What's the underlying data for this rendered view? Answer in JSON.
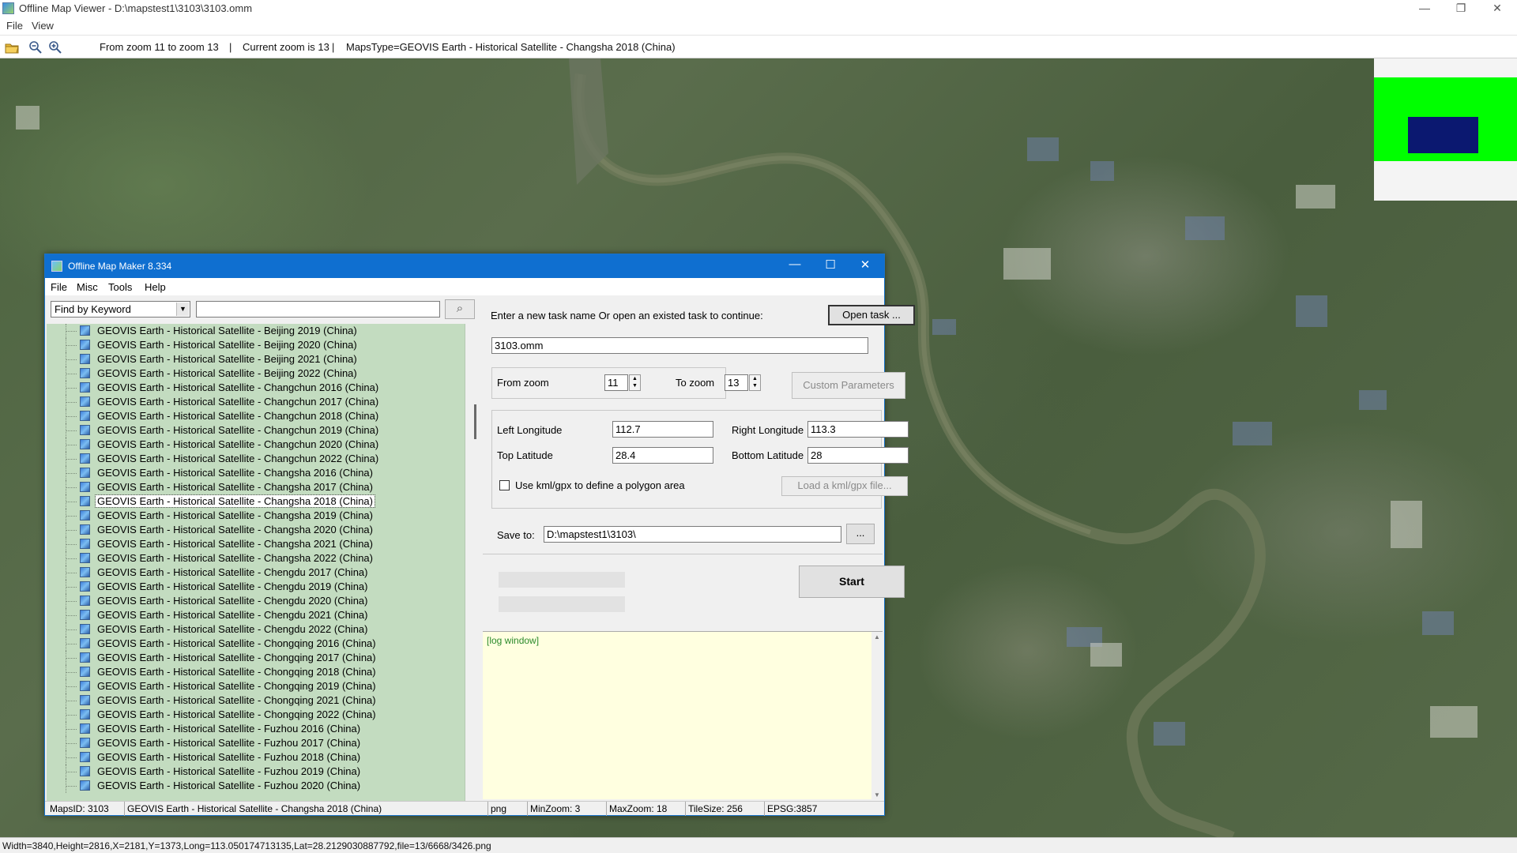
{
  "window": {
    "title": "Offline Map Viewer - D:\\mapstest1\\3103\\3103.omm",
    "min_icon": "—",
    "max_icon": "❐",
    "close_icon": "✕"
  },
  "menu": {
    "file": "File",
    "view": "View"
  },
  "toolbar": {
    "zoom_range": "From zoom 11 to zoom 13",
    "sep1": "|",
    "current_zoom": "Current zoom is 13",
    "sep2": "|",
    "maps_type": "MapsType=GEOVIS Earth - Historical Satellite - Changsha 2018 (China)"
  },
  "status": {
    "text": "Width=3840,Height=2816,X=2181,Y=1373,Long=113.050174713135,Lat=28.2129030887792,file=13/6668/3426.png"
  },
  "dialog": {
    "title": "Offline Map Maker 8.334",
    "min_icon": "—",
    "max_icon": "☐",
    "close_icon": "✕",
    "menu": {
      "file": "File",
      "misc": "Misc",
      "tools": "Tools",
      "help": "Help"
    },
    "find_mode": "Find by Keyword",
    "find_arrow": "▼",
    "find_value": "",
    "search_icon": "⌕",
    "tree": [
      "GEOVIS Earth - Historical Satellite - Beijing 2019 (China)",
      "GEOVIS Earth - Historical Satellite - Beijing 2020 (China)",
      "GEOVIS Earth - Historical Satellite - Beijing 2021 (China)",
      "GEOVIS Earth - Historical Satellite - Beijing 2022 (China)",
      "GEOVIS Earth - Historical Satellite - Changchun 2016 (China)",
      "GEOVIS Earth - Historical Satellite - Changchun 2017 (China)",
      "GEOVIS Earth - Historical Satellite - Changchun 2018 (China)",
      "GEOVIS Earth - Historical Satellite - Changchun 2019 (China)",
      "GEOVIS Earth - Historical Satellite - Changchun 2020 (China)",
      "GEOVIS Earth - Historical Satellite - Changchun 2022 (China)",
      "GEOVIS Earth - Historical Satellite - Changsha 2016 (China)",
      "GEOVIS Earth - Historical Satellite - Changsha 2017 (China)",
      "GEOVIS Earth - Historical Satellite - Changsha 2018 (China)",
      "GEOVIS Earth - Historical Satellite - Changsha 2019 (China)",
      "GEOVIS Earth - Historical Satellite - Changsha 2020 (China)",
      "GEOVIS Earth - Historical Satellite - Changsha 2021 (China)",
      "GEOVIS Earth - Historical Satellite - Changsha 2022 (China)",
      "GEOVIS Earth - Historical Satellite - Chengdu 2017 (China)",
      "GEOVIS Earth - Historical Satellite - Chengdu 2019 (China)",
      "GEOVIS Earth - Historical Satellite - Chengdu 2020 (China)",
      "GEOVIS Earth - Historical Satellite - Chengdu 2021 (China)",
      "GEOVIS Earth - Historical Satellite - Chengdu 2022 (China)",
      "GEOVIS Earth - Historical Satellite - Chongqing 2016 (China)",
      "GEOVIS Earth - Historical Satellite - Chongqing 2017 (China)",
      "GEOVIS Earth - Historical Satellite - Chongqing 2018 (China)",
      "GEOVIS Earth - Historical Satellite - Chongqing 2019 (China)",
      "GEOVIS Earth - Historical Satellite - Chongqing 2021 (China)",
      "GEOVIS Earth - Historical Satellite - Chongqing 2022 (China)",
      "GEOVIS Earth - Historical Satellite - Fuzhou 2016 (China)",
      "GEOVIS Earth - Historical Satellite - Fuzhou 2017 (China)",
      "GEOVIS Earth - Historical Satellite - Fuzhou 2018 (China)",
      "GEOVIS Earth - Historical Satellite - Fuzhou 2019 (China)",
      "GEOVIS Earth - Historical Satellite - Fuzhou 2020 (China)"
    ],
    "selected_item": "GEOVIS Earth - Historical Satellite - Changsha 2018 (China)",
    "task_prompt": "Enter a new task name Or open an existed task to continue:",
    "open_task": "Open task ...",
    "task_name": "3103.omm",
    "from_zoom_label": "From zoom",
    "from_zoom": "11",
    "to_zoom_label": "To zoom",
    "to_zoom": "13",
    "spin_up": "▲",
    "spin_down": "▼",
    "custom_params": "Custom Parameters",
    "left_lon_label": "Left Longitude",
    "left_lon": "112.7",
    "right_lon_label": "Right Longitude",
    "right_lon": "113.3",
    "top_lat_label": "Top Latitude",
    "top_lat": "28.4",
    "bottom_lat_label": "Bottom Latitude",
    "bottom_lat": "28",
    "use_kml_label": "Use kml/gpx to define a polygon area",
    "load_kml": "Load a kml/gpx file...",
    "save_to_label": "Save to:",
    "save_to": "D:\\mapstest1\\3103\\",
    "browse": "...",
    "start": "Start",
    "log_title": "[log window]",
    "log_up": "▲",
    "log_down": "▼",
    "status": {
      "maps_id": "MapsID: 3103",
      "maps_name": "GEOVIS Earth - Historical Satellite - Changsha 2018 (China)",
      "format": "png",
      "min_zoom": "MinZoom: 3",
      "max_zoom": "MaxZoom: 18",
      "tile_size": "TileSize: 256",
      "epsg": "EPSG:3857"
    }
  }
}
